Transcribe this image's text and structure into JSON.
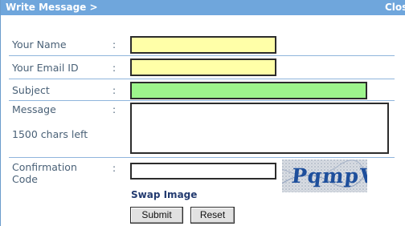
{
  "window": {
    "title": "Write Message >",
    "close_label": "Close"
  },
  "form": {
    "name_label": "Your Name",
    "email_label": "Your Email ID",
    "subject_label": "Subject",
    "message_label": "Message",
    "chars_left": "1500 chars left",
    "confirmation_label": "Confirmation Code",
    "colon": ":",
    "name_value": "",
    "email_value": "",
    "subject_value": "",
    "message_value": "",
    "code_value": "",
    "captcha_text": "PqmpV",
    "swap_label": "Swap Image",
    "submit_label": "Submit",
    "reset_label": "Reset"
  },
  "colors": {
    "titlebar": "#6fa6dc",
    "yellow_field": "#ffffa8",
    "green_field": "#9df58c",
    "captcha_text": "#1e4f9c"
  }
}
